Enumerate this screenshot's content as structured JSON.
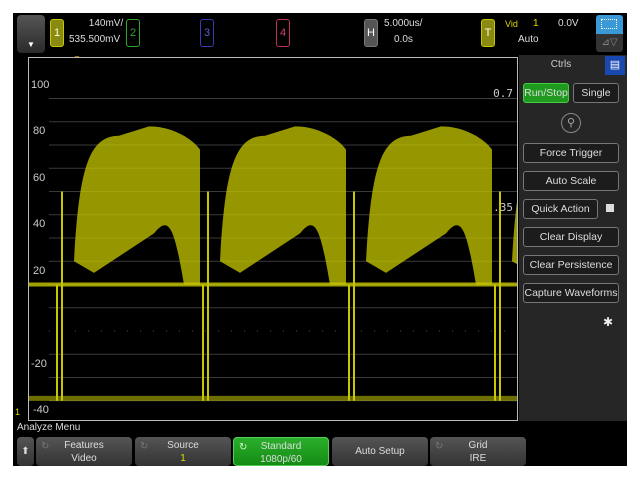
{
  "header": {
    "channel1": {
      "label": "1",
      "scale": "140mV/",
      "offset": "535.500mV",
      "color": "#c8c800"
    },
    "channel2": {
      "label": "2",
      "color": "#2fa82f"
    },
    "channel3": {
      "label": "3",
      "color": "#3a3ab8"
    },
    "channel4": {
      "label": "4",
      "color": "#c03060"
    },
    "horizontal": {
      "label": "H",
      "scale": "5.000us/",
      "delay": "0.0s"
    },
    "trigger": {
      "label": "T",
      "type": "Vid",
      "source": "1",
      "level": "0.0V",
      "mode": "Auto"
    }
  },
  "graticule": {
    "left_labels": [
      "100",
      "80",
      "60",
      "40",
      "20",
      "-20",
      "-40"
    ],
    "right_labels": [
      "0.7",
      ".35"
    ],
    "channel_marker": "1"
  },
  "side_panel": {
    "tab": "Ctrls",
    "buttons": [
      "Run/Stop",
      "Single",
      "Force Trigger",
      "Auto Scale",
      "Quick Action",
      "Clear Display",
      "Clear Persistence",
      "Capture Waveforms"
    ],
    "run_color": "#1f9a1f"
  },
  "softkeys": {
    "menu_title": "Analyze Menu",
    "keys": [
      {
        "label": "Features",
        "value": "Video"
      },
      {
        "label": "Source",
        "value": "1"
      },
      {
        "label": "Standard",
        "value": "1080p/60"
      },
      {
        "label": "Auto Setup",
        "value": ""
      },
      {
        "label": "Grid",
        "value": "IRE"
      }
    ]
  }
}
